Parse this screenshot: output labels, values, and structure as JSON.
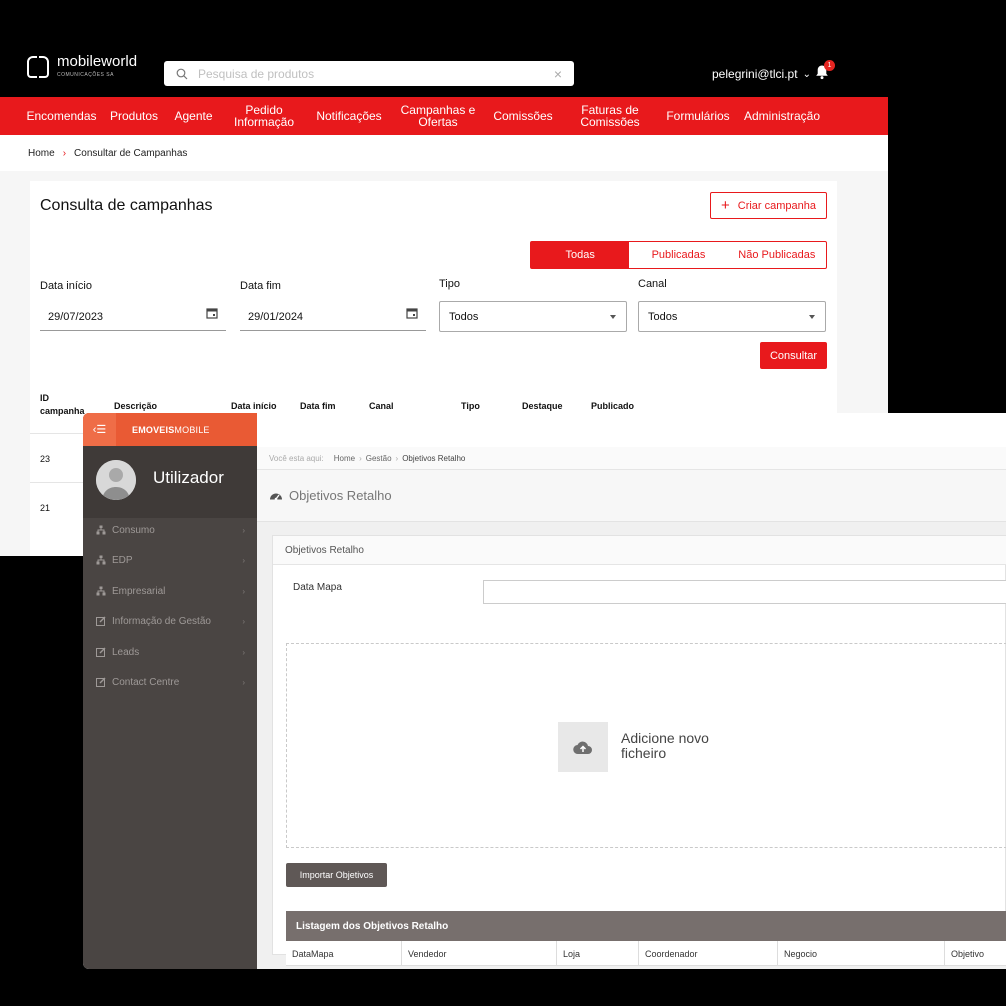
{
  "mobileworld": {
    "logo": {
      "name": "mobileworld",
      "subtitle": "COMUNICAÇÕES SA"
    },
    "search": {
      "placeholder": "Pesquisa de produtos",
      "clear": "×"
    },
    "user": {
      "email": "pelegrini@tlci.pt",
      "chevron": "⌄"
    },
    "notifications": {
      "count": "1"
    },
    "nav": [
      {
        "label": "Encomendas"
      },
      {
        "label": "Produtos"
      },
      {
        "label": "Agente"
      },
      {
        "label": "Pedido\nInformação"
      },
      {
        "label": "Notificações"
      },
      {
        "label": "Campanhas e\nOfertas"
      },
      {
        "label": "Comissões"
      },
      {
        "label": "Faturas de\nComissões"
      },
      {
        "label": "Formulários"
      },
      {
        "label": "Administração"
      }
    ],
    "breadcrumb": {
      "home": "Home",
      "sep": "›",
      "current": "Consultar de Campanhas"
    },
    "page_title": "Consulta de campanhas",
    "create_button": {
      "plus": "+",
      "label": "Criar campanha"
    },
    "filter_tabs": [
      {
        "label": "Todas",
        "active": true
      },
      {
        "label": "Publicadas",
        "active": false
      },
      {
        "label": "Não Publicadas",
        "active": false
      }
    ],
    "fields": {
      "start_label": "Data início",
      "start_value": "29/07/2023",
      "end_label": "Data fim",
      "end_value": "29/01/2024",
      "type_label": "Tipo",
      "type_value": "Todos",
      "channel_label": "Canal",
      "channel_value": "Todos"
    },
    "consult_button": "Consultar",
    "table": {
      "headers": [
        "ID\ncampanha",
        "Descrição",
        "Data início",
        "Data fim",
        "Canal",
        "Tipo",
        "Destaque",
        "Publicado"
      ],
      "rows": [
        {
          "id": "23"
        },
        {
          "id": "21"
        }
      ]
    }
  },
  "emoveis": {
    "brand_bold": "EMOVEIS",
    "brand_light": "MOBILE",
    "toggle": "‹☰",
    "username": "Utilizador",
    "menu": [
      {
        "label": "Consumo",
        "icon": "sitemap-icon"
      },
      {
        "label": "EDP",
        "icon": "sitemap-icon"
      },
      {
        "label": "Empresarial",
        "icon": "sitemap-icon"
      },
      {
        "label": "Informação de Gestão",
        "icon": "edit-icon"
      },
      {
        "label": "Leads",
        "icon": "edit-icon"
      },
      {
        "label": "Contact Centre",
        "icon": "edit-icon"
      }
    ],
    "menu_chevron": "›",
    "breadcrumb": {
      "prefix": "Você esta aqui:",
      "home": "Home",
      "section": "Gestão",
      "current": "Objetivos Retalho",
      "sep": "›"
    },
    "page_title": "Objetivos Retalho",
    "panel_title": "Objetivos Retalho",
    "form": {
      "label": "Data Mapa",
      "value": ""
    },
    "upload_text": "Adicione novo ficheiro",
    "import_button": "Importar Objetivos",
    "list": {
      "title": "Listagem dos Objetivos Retalho",
      "columns": [
        "DataMapa",
        "Vendedor",
        "Loja",
        "Coordenador",
        "Negocio",
        "Objetivo"
      ]
    }
  }
}
